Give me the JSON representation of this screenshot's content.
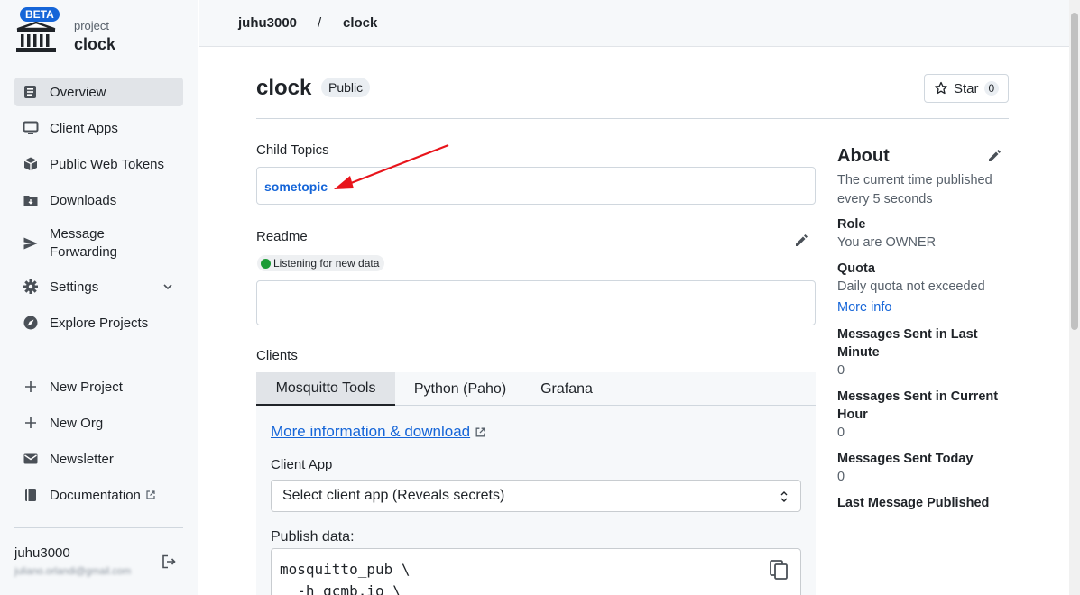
{
  "brand": {
    "badge": "BETA",
    "kicker": "project",
    "name": "clock"
  },
  "sidebar": {
    "items": [
      {
        "label": "Overview",
        "icon": "overview-icon",
        "active": true
      },
      {
        "label": "Client Apps",
        "icon": "monitor-icon"
      },
      {
        "label": "Public Web Tokens",
        "icon": "cube-icon"
      },
      {
        "label": "Downloads",
        "icon": "download-folder-icon"
      },
      {
        "label": "Message Forwarding",
        "icon": "send-icon"
      },
      {
        "label": "Settings",
        "icon": "gear-icon"
      },
      {
        "label": "Explore Projects",
        "icon": "compass-icon"
      },
      {
        "label": "New Project",
        "icon": "plus-icon"
      },
      {
        "label": "New Org",
        "icon": "plus-icon"
      },
      {
        "label": "Newsletter",
        "icon": "mail-icon"
      },
      {
        "label": "Documentation",
        "icon": "book-icon"
      }
    ]
  },
  "user": {
    "name": "juhu3000",
    "email": "juliano.orlandi@gmail.com"
  },
  "breadcrumb": {
    "owner": "juhu3000",
    "sep": "/",
    "project": "clock"
  },
  "header": {
    "title": "clock",
    "visibility": "Public",
    "star_label": "Star",
    "star_count": "0"
  },
  "child_topics": {
    "label": "Child Topics",
    "items": [
      "sometopic"
    ]
  },
  "readme": {
    "label": "Readme",
    "status": "Listening for new data"
  },
  "clients": {
    "label": "Clients",
    "tabs": [
      "Mosquitto Tools",
      "Python (Paho)",
      "Grafana"
    ],
    "active_tab": 0,
    "more_link": "More information & download",
    "client_app_label": "Client App",
    "select_value": "Select client app (Reveals secrets)",
    "publish_label": "Publish data:",
    "code_lines": [
      "mosquitto_pub \\",
      "  -h gcmb.io \\"
    ]
  },
  "about": {
    "title": "About",
    "description": "The current time published every 5 seconds",
    "role_label": "Role",
    "role_value": "You are OWNER",
    "quota_label": "Quota",
    "quota_value": "Daily quota not exceeded",
    "quota_link": "More info",
    "stats": [
      {
        "label": "Messages Sent in Last Minute",
        "value": "0"
      },
      {
        "label": "Messages Sent in Current Hour",
        "value": "0"
      },
      {
        "label": "Messages Sent Today",
        "value": "0"
      }
    ],
    "last_published_label": "Last Message Published"
  },
  "colors": {
    "accent": "#1565d8",
    "status_green": "#1a9b35",
    "arrow_red": "#e8141b"
  }
}
